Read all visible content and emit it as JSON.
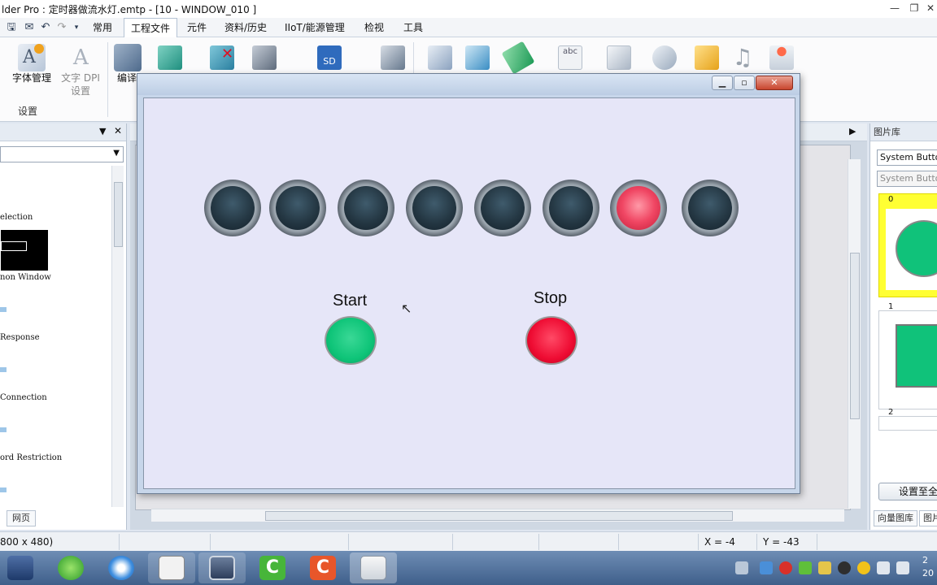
{
  "window": {
    "title": "lder Pro : 定时器做流水灯.emtp - [10 - WINDOW_010 ]",
    "minimize": "—",
    "restore": "❐",
    "close": "✕"
  },
  "menu": {
    "items": [
      "常用",
      "工程文件",
      "元件",
      "资料/历史",
      "IIoT/能源管理",
      "检视",
      "工具"
    ],
    "active_index": 1
  },
  "ribbon": {
    "font_manager": "字体管理",
    "text_dpi_line1": "文字 DPI",
    "text_dpi_line2": "设置",
    "compile": "编译",
    "group_settings": "设置",
    "sd_label": "SD",
    "abc_label": "abc"
  },
  "left_panel": {
    "items": [
      "election",
      "non Window",
      "Response",
      "Connection",
      "ord Restriction"
    ],
    "tab": "网页"
  },
  "popup": {
    "lamps": [
      {
        "on": false
      },
      {
        "on": false
      },
      {
        "on": false
      },
      {
        "on": false
      },
      {
        "on": false
      },
      {
        "on": false
      },
      {
        "on": true
      },
      {
        "on": false
      }
    ],
    "start_label": "Start",
    "stop_label": "Stop",
    "start_color": "#0ec478",
    "stop_color": "#ee0b32"
  },
  "right_panel": {
    "header": "图片库",
    "combo1": "System Button",
    "combo2": "System Button",
    "card_numbers": [
      "0",
      "1",
      "2"
    ],
    "apply_button": "设置至全",
    "tab1": "向量图库",
    "tab2": "图片"
  },
  "status": {
    "size": "800 x 480)",
    "x": "X = -4",
    "y": "Y = -43"
  },
  "taskbar": {
    "clock_line1": "2",
    "clock_line2": "20"
  },
  "colors": {
    "selection_yellow": "#ffff33",
    "green_shape": "#10c27a",
    "lamp_red": "#f04663"
  }
}
